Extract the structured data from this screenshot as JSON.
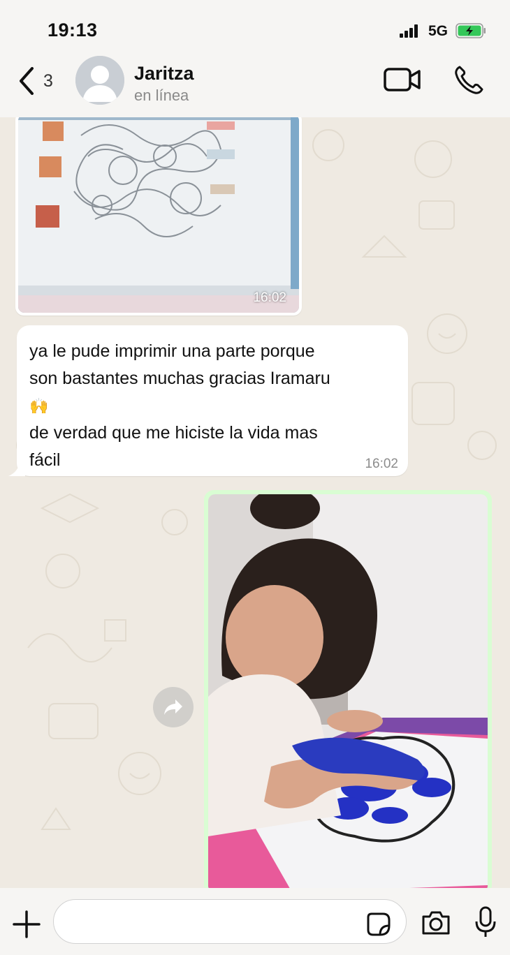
{
  "status_bar": {
    "time": "19:13",
    "network": "5G"
  },
  "header": {
    "back_count": "3",
    "contact_name": "Jaritza",
    "contact_status": "en línea"
  },
  "messages": [
    {
      "type": "image",
      "direction": "incoming",
      "time": "16:02"
    },
    {
      "type": "text",
      "direction": "incoming",
      "lines": [
        "ya le pude imprimir una parte porque",
        "son bastantes muchas gracias Iramaru",
        "🙌",
        "de verdad que me hiciste la vida mas",
        "fácil"
      ],
      "time": "16:02"
    },
    {
      "type": "image",
      "direction": "outgoing"
    }
  ],
  "colors": {
    "chat_background": "#efeae2",
    "outgoing_bubble": "#d9fdd3",
    "incoming_bubble": "#ffffff",
    "battery_fill": "#34c759"
  },
  "input": {
    "placeholder": ""
  }
}
